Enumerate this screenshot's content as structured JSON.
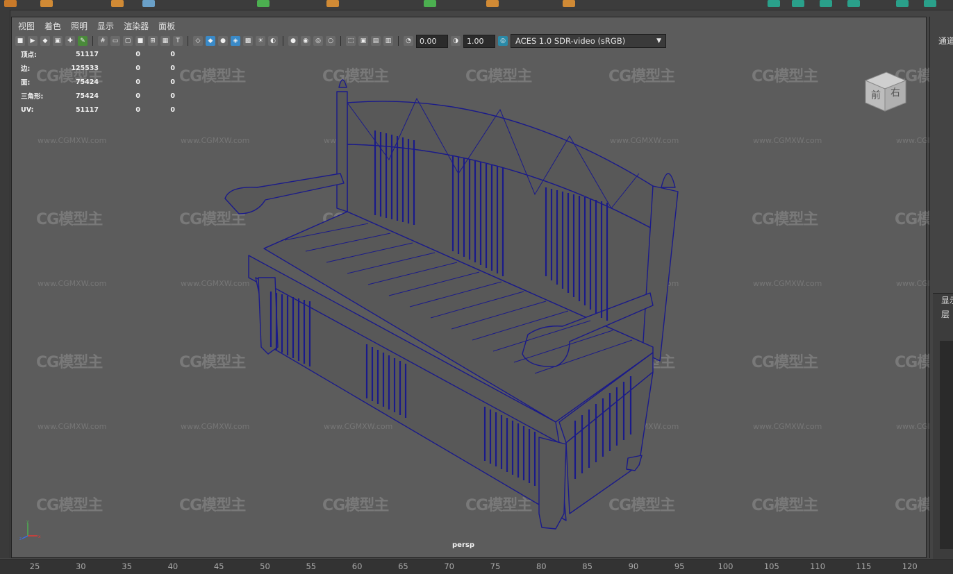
{
  "panel_menu": [
    "视图",
    "着色",
    "照明",
    "显示",
    "渲染器",
    "面板"
  ],
  "toolbar": {
    "exposure": "0.00",
    "gamma": "1.00",
    "color_space": "ACES 1.0 SDR-video (sRGB)"
  },
  "hud": {
    "rows": [
      {
        "label": "顶点:",
        "v1": "51117",
        "v2": "0",
        "v3": "0"
      },
      {
        "label": "边:",
        "v1": "125533",
        "v2": "0",
        "v3": "0"
      },
      {
        "label": "面:",
        "v1": "75424",
        "v2": "0",
        "v3": "0"
      },
      {
        "label": "三角形:",
        "v1": "75424",
        "v2": "0",
        "v3": "0"
      },
      {
        "label": "UV:",
        "v1": "51117",
        "v2": "0",
        "v3": "0"
      }
    ]
  },
  "viewcube": {
    "front": "前",
    "right": "右"
  },
  "camera_label": "persp",
  "timeline_ticks": [
    "25",
    "30",
    "35",
    "40",
    "45",
    "50",
    "55",
    "60",
    "65",
    "70",
    "75",
    "80",
    "85",
    "90",
    "95",
    "100",
    "105",
    "110",
    "115",
    "120"
  ],
  "right_panel": {
    "top_label": "通道",
    "display_label": "显示",
    "layer_label": "层"
  },
  "watermark": {
    "logo": "CG模型主",
    "url": "www.CGMXW.com"
  },
  "colors": {
    "wireframe": "#1a1a8a",
    "viewport_bg": "#5c5c5c"
  }
}
